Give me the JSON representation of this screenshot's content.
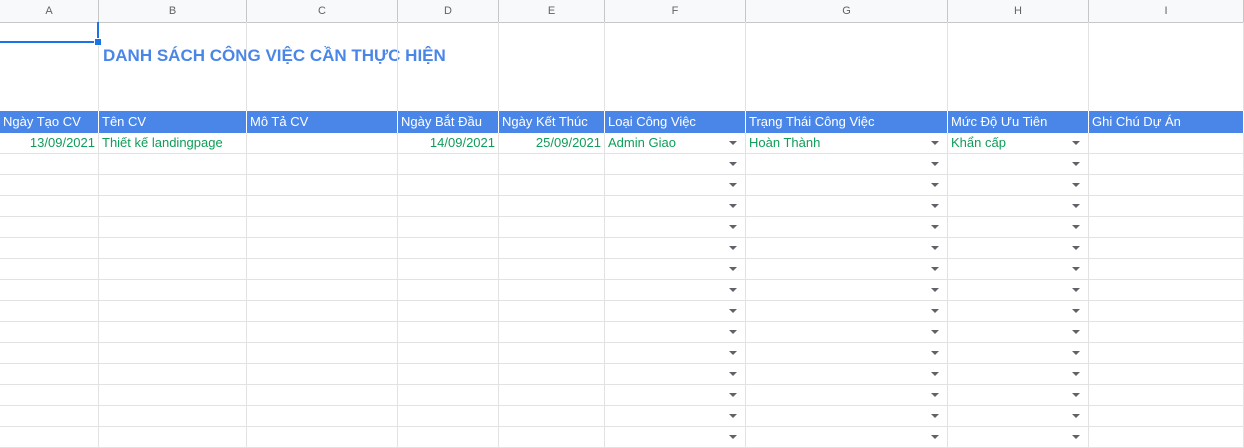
{
  "columns": [
    "A",
    "B",
    "C",
    "D",
    "E",
    "F",
    "G",
    "H",
    "I"
  ],
  "title": "DANH SÁCH CÔNG VIỆC CẦN THỰC HIỆN",
  "headers": [
    "Ngày Tạo CV",
    "Tên CV",
    "Mô Tả CV",
    "Ngày Bắt Đầu",
    "Ngày Kết Thúc",
    "Loại Công Việc",
    "Trạng Thái Công Việc",
    "Mức Độ Ưu Tiên",
    "Ghi Chú Dự Án"
  ],
  "rows": [
    [
      "13/09/2021",
      "Thiết kế landingpage",
      "",
      "14/09/2021",
      "25/09/2021",
      "Admin Giao",
      "Hoàn Thành",
      "Khẩn cấp",
      ""
    ],
    [
      "",
      "",
      "",
      "",
      "",
      "",
      "",
      "",
      ""
    ],
    [
      "",
      "",
      "",
      "",
      "",
      "",
      "",
      "",
      ""
    ],
    [
      "",
      "",
      "",
      "",
      "",
      "",
      "",
      "",
      ""
    ],
    [
      "",
      "",
      "",
      "",
      "",
      "",
      "",
      "",
      ""
    ],
    [
      "",
      "",
      "",
      "",
      "",
      "",
      "",
      "",
      ""
    ],
    [
      "",
      "",
      "",
      "",
      "",
      "",
      "",
      "",
      ""
    ],
    [
      "",
      "",
      "",
      "",
      "",
      "",
      "",
      "",
      ""
    ],
    [
      "",
      "",
      "",
      "",
      "",
      "",
      "",
      "",
      ""
    ],
    [
      "",
      "",
      "",
      "",
      "",
      "",
      "",
      "",
      ""
    ],
    [
      "",
      "",
      "",
      "",
      "",
      "",
      "",
      "",
      ""
    ],
    [
      "",
      "",
      "",
      "",
      "",
      "",
      "",
      "",
      ""
    ],
    [
      "",
      "",
      "",
      "",
      "",
      "",
      "",
      "",
      ""
    ],
    [
      "",
      "",
      "",
      "",
      "",
      "",
      "",
      "",
      ""
    ],
    [
      "",
      "",
      "",
      "",
      "",
      "",
      "",
      "",
      ""
    ]
  ],
  "colors": {
    "header_bg": "#4a86e8",
    "title": "#4a86e8",
    "value_text": "#0f9d58"
  },
  "dropdown_columns": [
    5,
    6,
    7
  ],
  "dropdown_icon": "chevron-down-icon"
}
